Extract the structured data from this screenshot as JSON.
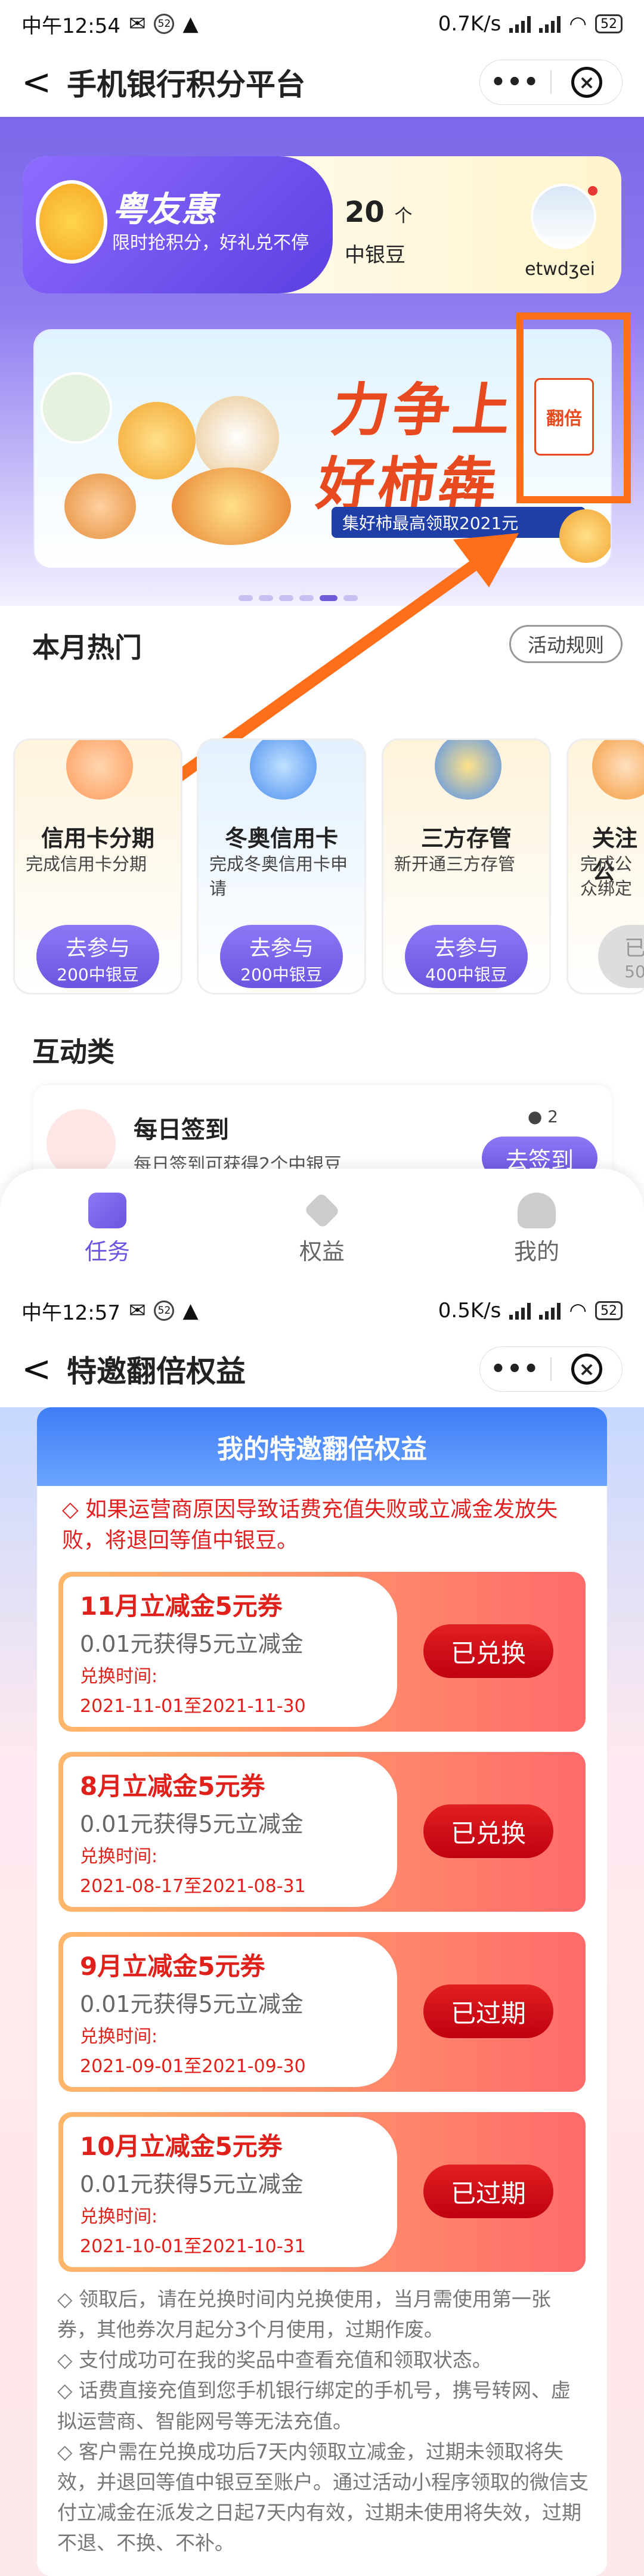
{
  "screen1": {
    "status": {
      "time": "中午12:54",
      "badge": "52",
      "speed": "0.7K/s",
      "battery": "52"
    },
    "nav": {
      "back": "<",
      "title": "手机银行积分平台",
      "more": "•••",
      "close": "×"
    },
    "promo": {
      "brand": "粤友惠",
      "slogan": "限时抢积分，好礼兑不停",
      "points": "20",
      "points_unit": "个",
      "points_label": "中银豆",
      "username": "etwdʒei"
    },
    "banner": {
      "line1": "力争上",
      "line2": "好柿犇",
      "strip": "集好柿最高领取2021元",
      "badge": "翻倍"
    },
    "section_hot": "本月热门",
    "rules_btn": "活动规则",
    "cards": [
      {
        "title": "信用卡分期",
        "desc": "完成信用卡分期",
        "btn": "去参与",
        "reward": "200中银豆"
      },
      {
        "title": "冬奥信用卡",
        "desc": "完成冬奥信用卡申请",
        "btn": "去参与",
        "reward": "200中银豆"
      },
      {
        "title": "三方存管",
        "desc": "新开通三方存管",
        "btn": "去参与",
        "reward": "400中银豆"
      },
      {
        "title": "关注公",
        "desc": "完成公众绑定",
        "btn": "已",
        "reward": "50"
      }
    ],
    "section_interact": "互动类",
    "checkin": {
      "title": "每日签到",
      "desc": "每日签到可获得2个中银豆",
      "coins": "2",
      "btn": "去签到"
    },
    "tabs": [
      "任务",
      "权益",
      "我的"
    ]
  },
  "screen2": {
    "status": {
      "time": "中午12:57",
      "badge": "52",
      "speed": "0.5K/s",
      "battery": "52"
    },
    "nav": {
      "back": "<",
      "title": "特邀翻倍权益",
      "more": "•••",
      "close": "×"
    },
    "panel_title": "我的特邀翻倍权益",
    "notice": "◇ 如果运营商原因导致话费充值失败或立减金发放失败，将退回等值中银豆。",
    "coupons": [
      {
        "title": "11月立减金5元券",
        "desc": "0.01元获得5元立减金",
        "label": "兑换时间:",
        "date": "2021-11-01至2021-11-30",
        "status": "已兑换"
      },
      {
        "title": "8月立减金5元券",
        "desc": "0.01元获得5元立减金",
        "label": "兑换时间:",
        "date": "2021-08-17至2021-08-31",
        "status": "已兑换"
      },
      {
        "title": "9月立减金5元券",
        "desc": "0.01元获得5元立减金",
        "label": "兑换时间:",
        "date": "2021-09-01至2021-09-30",
        "status": "已过期"
      },
      {
        "title": "10月立减金5元券",
        "desc": "0.01元获得5元立减金",
        "label": "兑换时间:",
        "date": "2021-10-01至2021-10-31",
        "status": "已过期"
      }
    ],
    "rules": [
      "◇ 领取后，请在兑换时间内兑换使用，当月需使用第一张券，其他券次月起分3个月使用，过期作废。",
      "◇ 支付成功可在我的奖品中查看充值和领取状态。",
      "◇ 话费直接充值到您手机银行绑定的手机号，携号转网、虚拟运营商、智能网号等无法充值。",
      "◇ 客户需在兑换成功后7天内领取立减金，过期未领取将失效，并退回等值中银豆至账户。通过活动小程序领取的微信支付立减金在派发之日起7天内有效，过期未使用将失效，过期不退、不换、不补。"
    ]
  }
}
